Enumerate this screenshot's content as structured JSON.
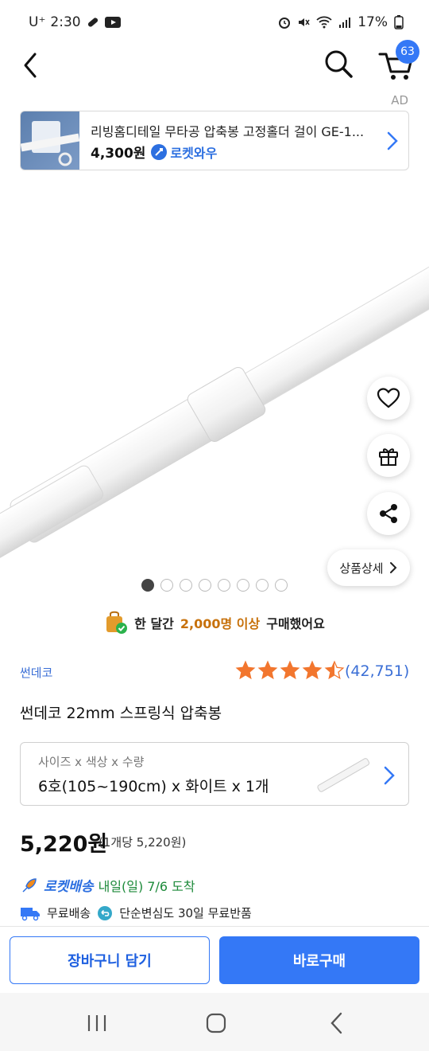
{
  "status_bar": {
    "carrier": "U⁺",
    "time": "2:30",
    "battery": "17%"
  },
  "header": {
    "cart_count": "63"
  },
  "ad": {
    "label": "AD",
    "title": "리빙홈디테일 무타공 압축봉 고정홀더 걸이 GE-1...",
    "price": "4,300원",
    "rocket_label": "로켓와우"
  },
  "image_carousel": {
    "total": 8,
    "active_index": 0
  },
  "floating": {
    "detail_label": "상품상세"
  },
  "purchase_info": {
    "prefix": "한 달간",
    "highlight": "2,000명 이상",
    "suffix": "구매했어요"
  },
  "product": {
    "brand": "썬데코",
    "rating": 4.5,
    "review_count": "(42,751)",
    "title": "썬데코 22mm 스프링식 압축봉",
    "option_label": "사이즈 x 색상 x 수량",
    "option_value": "6호(105~190cm) x 화이트 x 1개",
    "price": "5,220원",
    "unit_price": "(1개당 5,220원)"
  },
  "delivery": {
    "rocket_label": "로켓배송",
    "eta": "내일(일) 7/6 도착",
    "free_shipping": "무료배송",
    "return_policy": "단순변심도 30일 무료반품"
  },
  "actions": {
    "add_to_cart": "장바구니 담기",
    "buy_now": "바로구매"
  },
  "colors": {
    "accent": "#3478f6",
    "brand_link": "#3b6fd6",
    "star": "#f2762e",
    "eta_green": "#1d8a3a"
  }
}
